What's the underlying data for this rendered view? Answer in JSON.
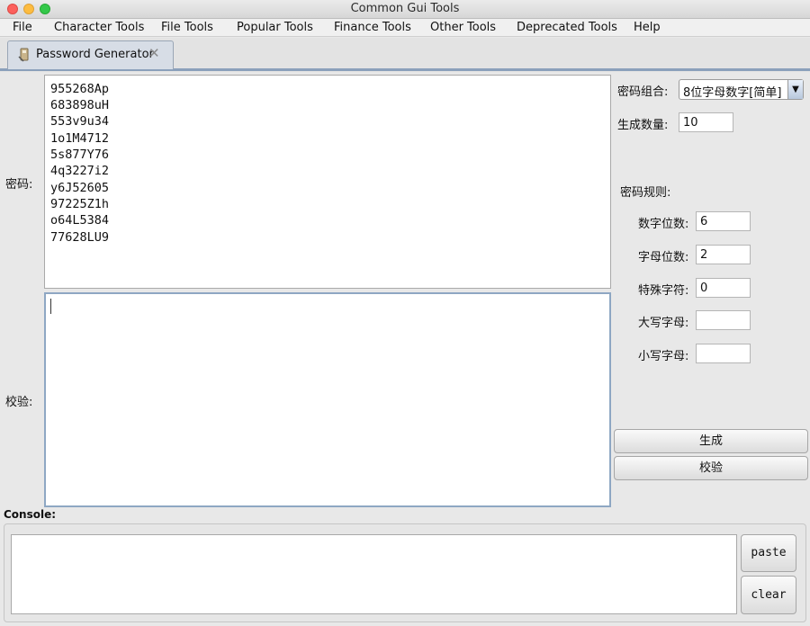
{
  "window": {
    "title": "Common Gui Tools"
  },
  "menu": [
    "File",
    "Character Tools",
    "File Tools",
    "Popular Tools",
    "Finance Tools",
    "Other Tools",
    "Deprecated Tools",
    "Help"
  ],
  "tab": {
    "label": "Password Generator",
    "close_glyph": "✕",
    "icon": "tab-tool-icon"
  },
  "password_area": {
    "label": "密码:",
    "lines": [
      "955268Ap",
      "683898uH",
      "553v9u34",
      "1o1M4712",
      "5s877Y76",
      "4q3227i2",
      "y6J52605",
      "97225Z1h",
      "o64L5384",
      "77628LU9"
    ]
  },
  "verify_area": {
    "label": "校验:",
    "value": ""
  },
  "options": {
    "combo_label": "密码组合:",
    "combo_value": "8位字母数字[简单]",
    "count_label": "生成数量:",
    "count_value": "10",
    "rules_title": "密码规则:",
    "rules": [
      {
        "label": "数字位数:",
        "value": "6"
      },
      {
        "label": "字母位数:",
        "value": "2"
      },
      {
        "label": "特殊字符:",
        "value": "0"
      },
      {
        "label": "大写字母:",
        "value": ""
      },
      {
        "label": "小写字母:",
        "value": ""
      }
    ]
  },
  "buttons": {
    "generate": "生成",
    "verify": "校验",
    "paste": "paste",
    "clear": "clear"
  },
  "console": {
    "label": "Console:",
    "value": ""
  }
}
